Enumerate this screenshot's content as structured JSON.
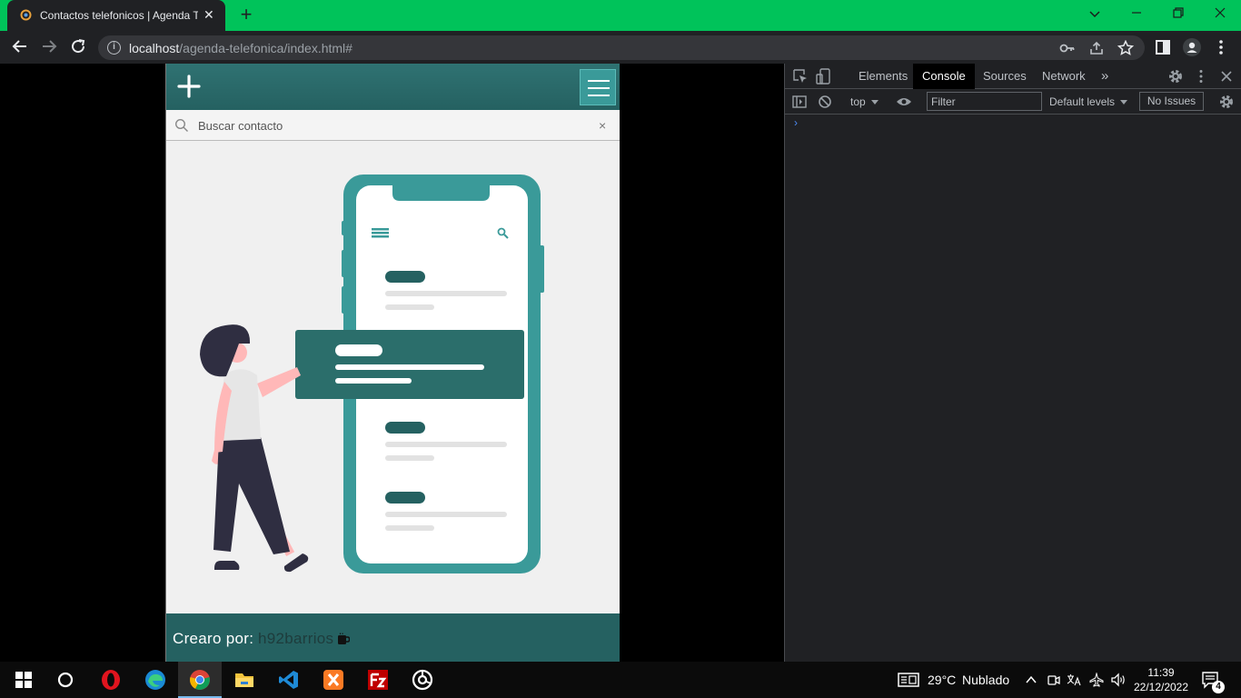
{
  "browser": {
    "tab_title": "Contactos telefonicos | Agenda Te",
    "tab_close": "✕",
    "new_tab": "+",
    "url_host": "localhost",
    "url_path": "/agenda-telefonica/index.html#",
    "accent_color": "#00c35a"
  },
  "app": {
    "search_placeholder": "Buscar contacto",
    "search_clear": "×",
    "footer_label": "Crearo por:",
    "footer_author": "h92barrios",
    "primary_color": "#256161",
    "accent_color": "#3a9a99",
    "illustration_icons": [
      "menu-icon",
      "search-icon"
    ]
  },
  "devtools": {
    "tabs": [
      "Elements",
      "Console",
      "Sources",
      "Network"
    ],
    "active_tab": "Console",
    "more_tabs": "»",
    "context": "top",
    "filter_placeholder": "Filter",
    "levels": "Default levels",
    "issues": "No Issues",
    "prompt": "›"
  },
  "taskbar": {
    "apps": [
      "start-icon",
      "cortana-icon",
      "opera-icon",
      "edge-icon",
      "chrome-icon",
      "file-explorer-icon",
      "vscode-icon",
      "xampp-icon",
      "filezilla-icon",
      "obs-icon"
    ],
    "weather": "29°C",
    "weather_text": "Nublado",
    "time": "11:39",
    "date": "22/12/2022",
    "notifications": "4"
  }
}
